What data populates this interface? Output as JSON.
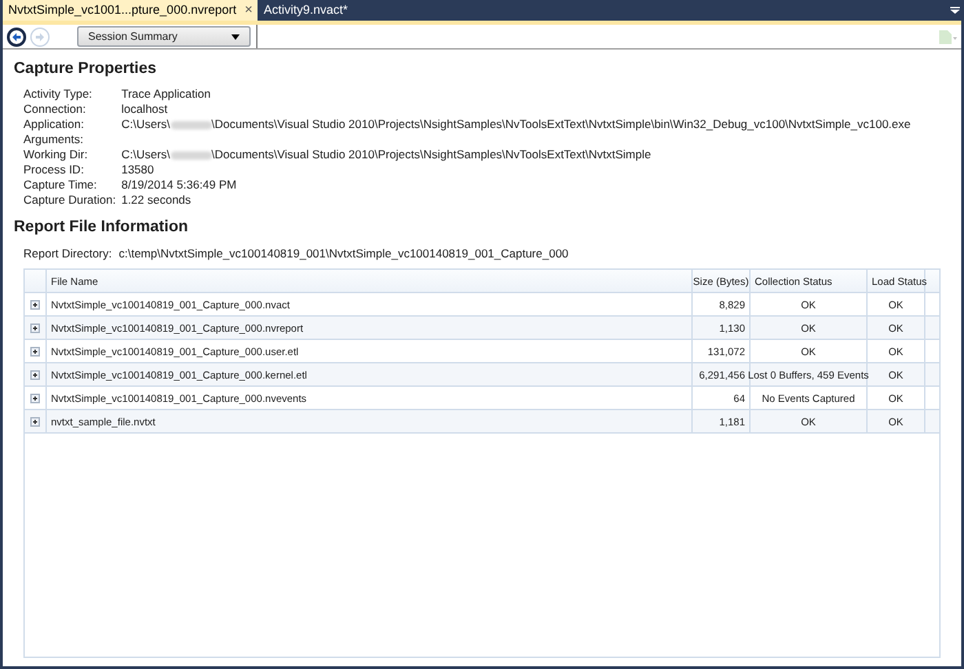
{
  "tabs": [
    {
      "label": "NvtxtSimple_vc1001...pture_000.nvreport",
      "selected": true,
      "close": "×"
    },
    {
      "label": "Activity9.nvact*",
      "selected": false
    }
  ],
  "toolbar": {
    "dropdown": "Session Summary"
  },
  "capture_properties": {
    "title": "Capture Properties",
    "items": [
      {
        "label": "Activity Type:",
        "kind": "plain",
        "value": "Trace Application"
      },
      {
        "label": "Connection:",
        "kind": "plain",
        "value": "localhost"
      },
      {
        "label": "Application:",
        "kind": "redacted",
        "before": "C:\\Users\\",
        "after": "\\Documents\\Visual Studio 2010\\Projects\\NsightSamples\\NvToolsExtText\\NvtxtSimple\\bin\\Win32_Debug_vc100\\NvtxtSimple_vc100.exe"
      },
      {
        "label": "Arguments:",
        "kind": "plain"
      },
      {
        "label": "Working Dir:",
        "kind": "redacted",
        "before": "C:\\Users\\",
        "after": "\\Documents\\Visual Studio 2010\\Projects\\NsightSamples\\NvToolsExtText\\NvtxtSimple"
      },
      {
        "label": "Process ID:",
        "kind": "plain",
        "value": "13580"
      },
      {
        "label": "Capture Time:",
        "kind": "plain",
        "value": "8/19/2014 5:36:49 PM"
      },
      {
        "label": "Capture Duration:",
        "kind": "plain",
        "value": "1.22 seconds"
      }
    ]
  },
  "report_file_information": {
    "title": "Report File Information",
    "directory_label": "Report Directory:",
    "directory": "c:\\temp\\NvtxtSimple_vc100140819_001\\NvtxtSimple_vc100140819_001_Capture_000",
    "table": {
      "columns": [
        "File Name",
        "Size (Bytes)",
        "Collection Status",
        "Load Status"
      ],
      "rows": [
        {
          "file": "NvtxtSimple_vc100140819_001_Capture_000.nvact",
          "size": "8,829",
          "collection": "OK",
          "load": "OK"
        },
        {
          "file": "NvtxtSimple_vc100140819_001_Capture_000.nvreport",
          "size": "1,130",
          "collection": "OK",
          "load": "OK"
        },
        {
          "file": "NvtxtSimple_vc100140819_001_Capture_000.user.etl",
          "size": "131,072",
          "collection": "OK",
          "load": "OK"
        },
        {
          "file": "NvtxtSimple_vc100140819_001_Capture_000.kernel.etl",
          "size": "6,291,456",
          "collection": "Lost 0 Buffers, 459 Events",
          "load": "OK"
        },
        {
          "file": "NvtxtSimple_vc100140819_001_Capture_000.nvevents",
          "size": "64",
          "collection": "No Events Captured",
          "load": "OK"
        },
        {
          "file": "nvtxt_sample_file.nvtxt",
          "size": "1,181",
          "collection": "OK",
          "load": "OK"
        }
      ]
    }
  }
}
